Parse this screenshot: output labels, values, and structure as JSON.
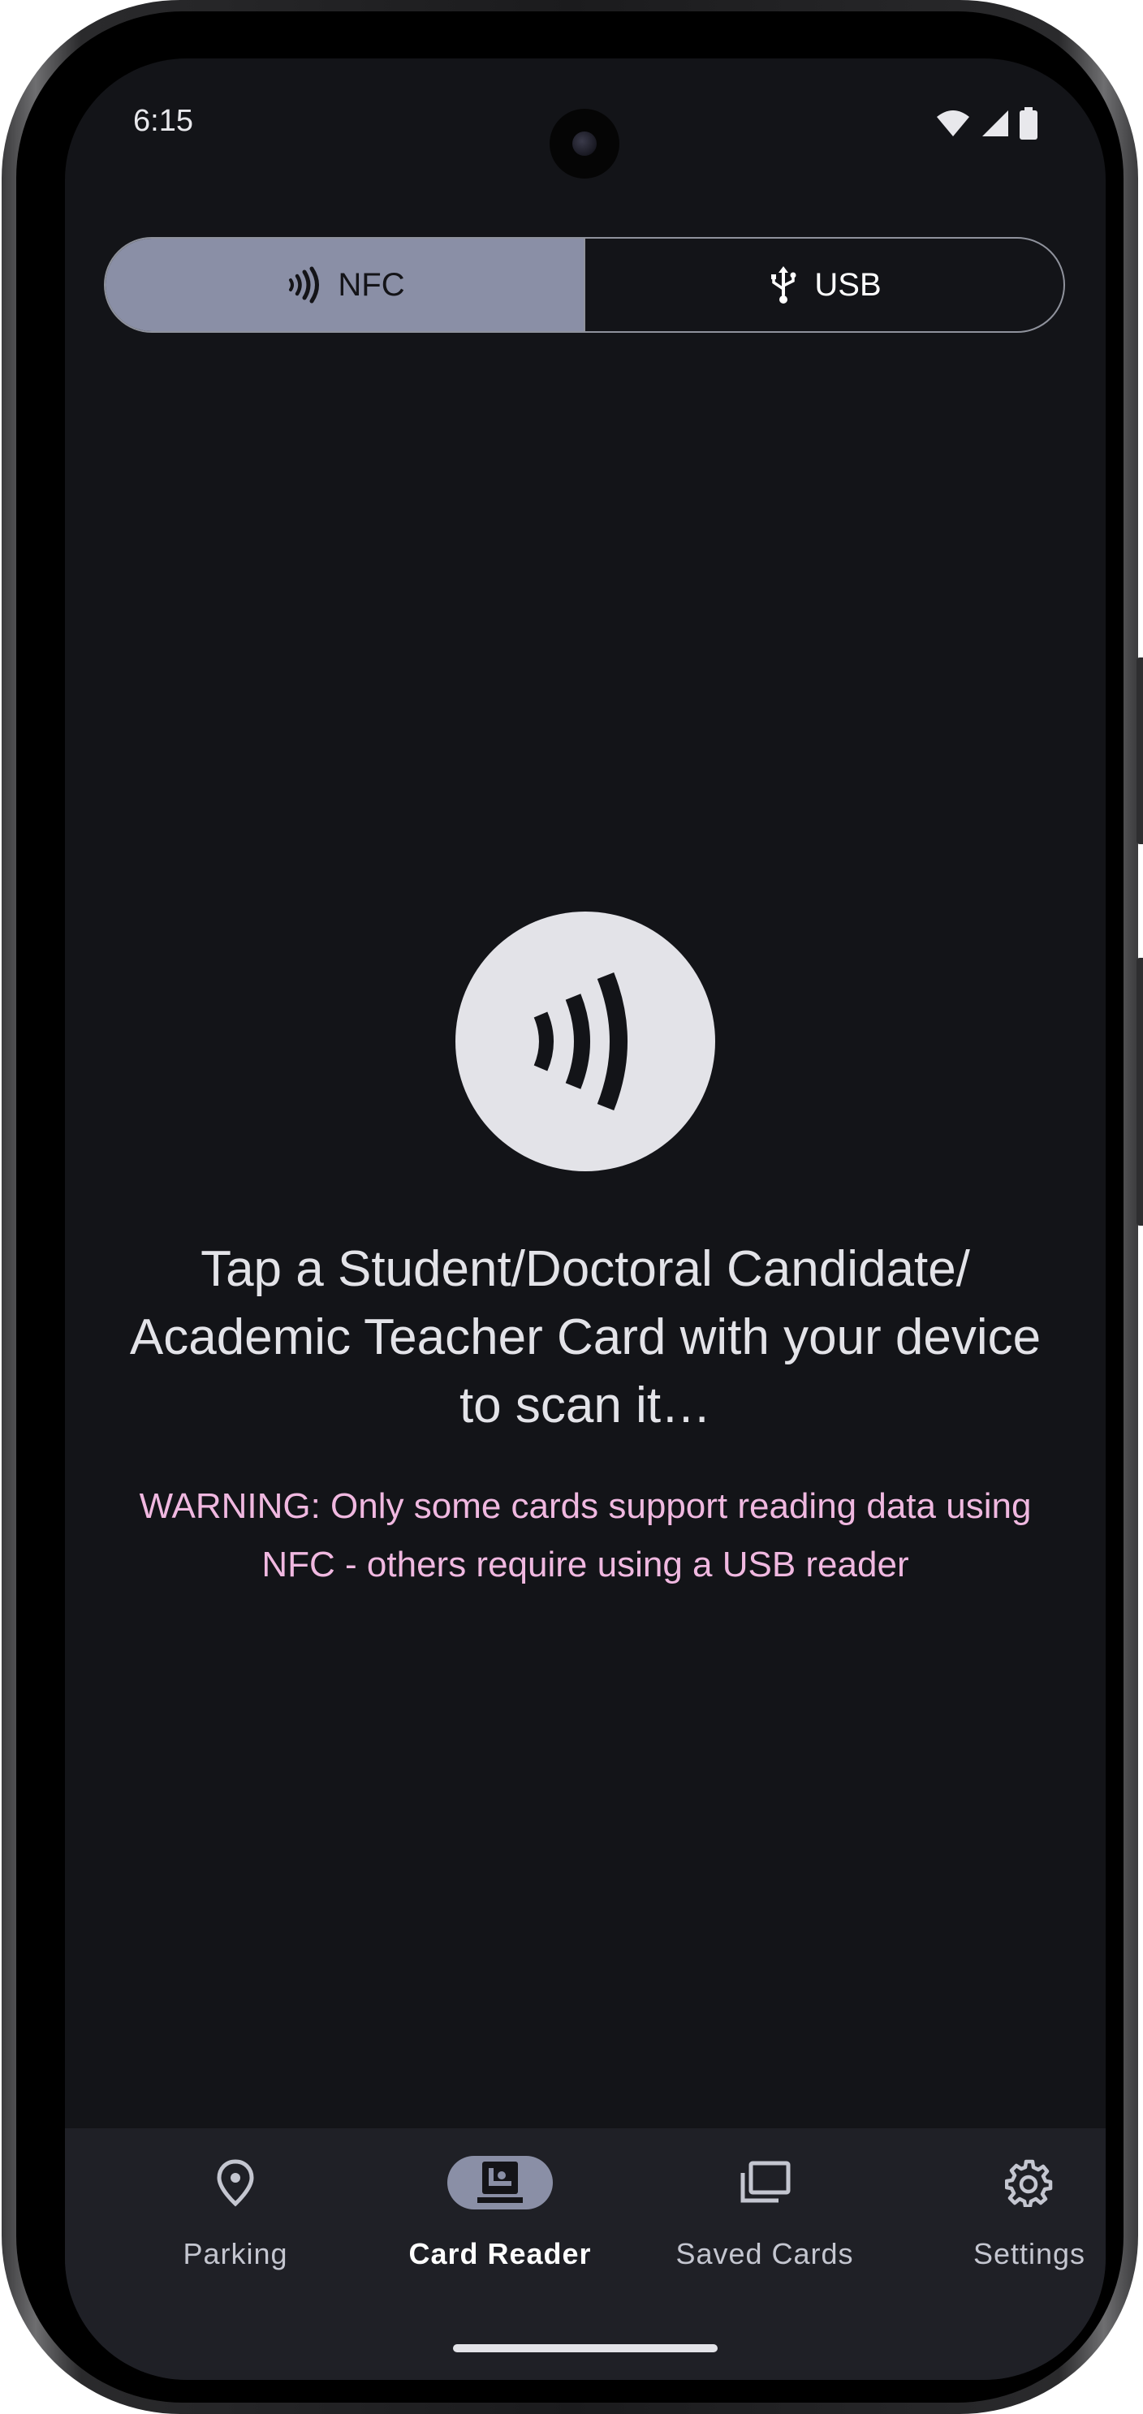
{
  "status_bar": {
    "time": "6:15",
    "icons": [
      "wifi-icon",
      "signal-icon",
      "battery-icon"
    ]
  },
  "mode_toggle": {
    "options": [
      {
        "label": "NFC",
        "icon": "nfc-icon",
        "selected": true
      },
      {
        "label": "USB",
        "icon": "usb-icon",
        "selected": false
      }
    ]
  },
  "main": {
    "hero_icon": "nfc-icon",
    "prompt": "Tap a Student/Doctoral Candidate/ Academic Teacher Card with your device to scan it…",
    "warning": "WARNING: Only some cards support reading data using NFC - others require using a USB reader"
  },
  "nav": {
    "items": [
      {
        "label": "Parking",
        "icon": "location-pin-icon",
        "selected": false
      },
      {
        "label": "Card Reader",
        "icon": "card-reader-icon",
        "selected": true
      },
      {
        "label": "Saved Cards",
        "icon": "cards-stack-icon",
        "selected": false
      },
      {
        "label": "Settings",
        "icon": "gear-icon",
        "selected": false
      }
    ]
  },
  "colors": {
    "background": "#131418",
    "accent": "#8a8fa6",
    "warning": "#f0b8e0",
    "navbar": "#1f2026"
  }
}
